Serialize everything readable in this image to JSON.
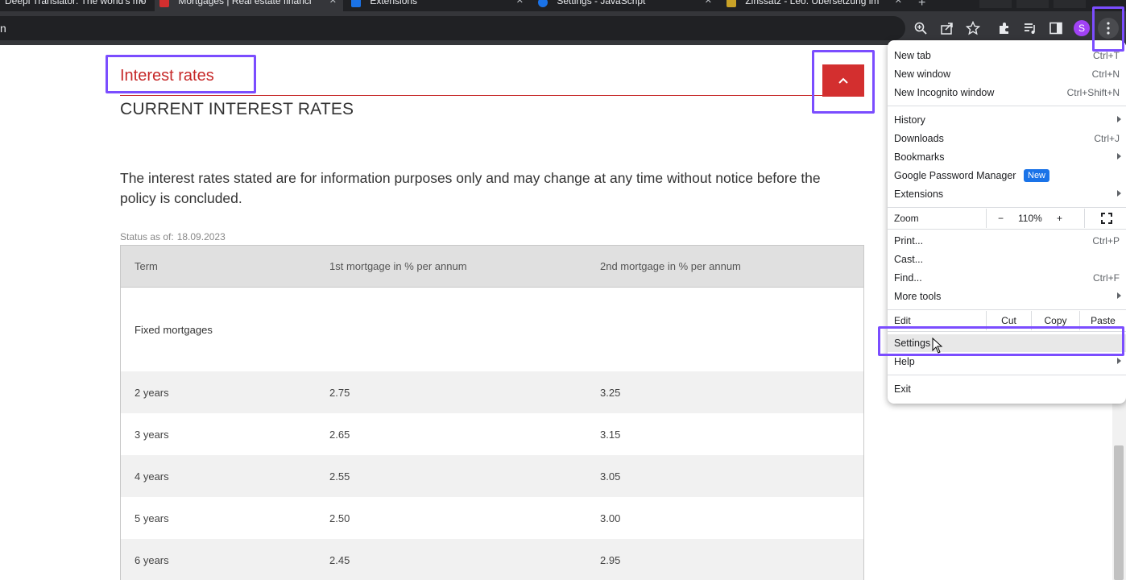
{
  "browser": {
    "tabs": [
      {
        "label": "Deepl Translator: The world's mo",
        "close": "✕"
      },
      {
        "label": "Mortgages | Real estate financi",
        "close": "✕"
      },
      {
        "label": "Extensions",
        "close": "✕"
      },
      {
        "label": "Settings - JavaScript",
        "close": "✕"
      },
      {
        "label": "Zinssatz - Leo: Übersetzung im",
        "close": "✕"
      }
    ],
    "new_tab": "+",
    "omnibox_text": "n",
    "profile_initial": "S",
    "icons": [
      "zoom-icon",
      "share-icon",
      "bookmark-star-icon",
      "extensions-icon",
      "reading-list-icon",
      "side-panel-icon",
      "kebab-menu-icon"
    ]
  },
  "page": {
    "section_title": "Interest rates",
    "heading": "CURRENT INTEREST RATES",
    "disclaimer": "The interest rates stated are for information purposes only and may change at any time without notice before the policy is concluded.",
    "status_label": "Status as of:",
    "status_date": "18.09.2023",
    "table": {
      "headers": [
        "Term",
        "1st mortgage in % per annum",
        "2nd mortgage in % per annum"
      ],
      "group_label": "Fixed mortgages",
      "rows": [
        [
          "2 years",
          "2.75",
          "3.25"
        ],
        [
          "3 years",
          "2.65",
          "3.15"
        ],
        [
          "4 years",
          "2.55",
          "3.05"
        ],
        [
          "5 years",
          "2.50",
          "3.00"
        ],
        [
          "6 years",
          "2.45",
          "2.95"
        ]
      ]
    }
  },
  "menu": {
    "new_tab": {
      "label": "New tab",
      "shortcut": "Ctrl+T"
    },
    "new_window": {
      "label": "New window",
      "shortcut": "Ctrl+N"
    },
    "incognito": {
      "label": "New Incognito window",
      "shortcut": "Ctrl+Shift+N"
    },
    "history": {
      "label": "History"
    },
    "downloads": {
      "label": "Downloads",
      "shortcut": "Ctrl+J"
    },
    "bookmarks": {
      "label": "Bookmarks"
    },
    "passwords": {
      "label": "Google Password Manager",
      "badge": "New"
    },
    "extensions": {
      "label": "Extensions"
    },
    "zoom": {
      "label": "Zoom",
      "minus": "−",
      "value": "110%",
      "plus": "+"
    },
    "print": {
      "label": "Print...",
      "shortcut": "Ctrl+P"
    },
    "cast": {
      "label": "Cast..."
    },
    "find": {
      "label": "Find...",
      "shortcut": "Ctrl+F"
    },
    "more_tools": {
      "label": "More tools"
    },
    "edit": {
      "label": "Edit",
      "cut": "Cut",
      "copy": "Copy",
      "paste": "Paste"
    },
    "settings": {
      "label": "Settings"
    },
    "help": {
      "label": "Help"
    },
    "exit": {
      "label": "Exit"
    }
  },
  "colors": {
    "accent_red": "#d32f2f",
    "highlight": "#7b4dff",
    "badge_blue": "#1a73e8"
  }
}
